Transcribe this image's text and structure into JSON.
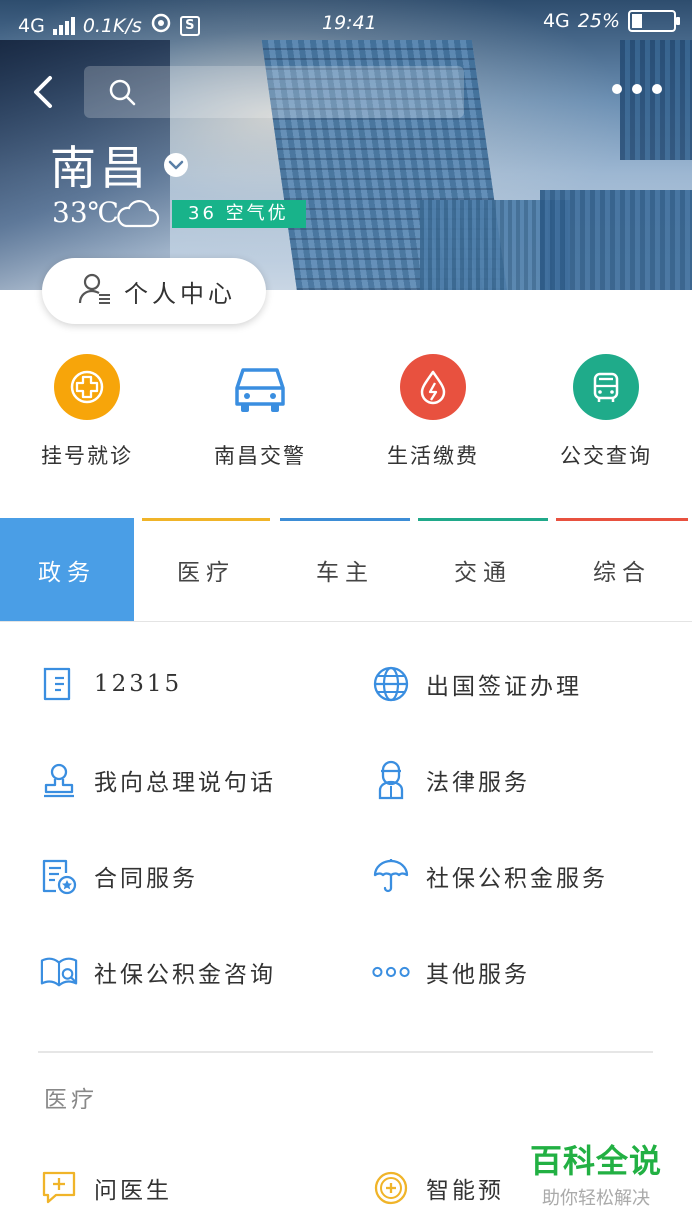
{
  "status_bar": {
    "network": "4G",
    "speed": "0.1K/s",
    "time": "19:41",
    "network_right": "4G",
    "battery": "25%"
  },
  "search": {
    "placeholder": ""
  },
  "location": {
    "city": "南昌",
    "temperature": "33℃",
    "weather_icon": "cloud-icon",
    "air_quality": "36 空气优",
    "air_quality_color": "#18b38a"
  },
  "personal_center": {
    "label": "个人中心"
  },
  "quick_services": [
    {
      "label": "挂号就诊",
      "icon": "medical-cross-icon",
      "color": "#f7a50a"
    },
    {
      "label": "南昌交警",
      "icon": "car-icon",
      "color": "#3a8ee0"
    },
    {
      "label": "生活缴费",
      "icon": "bill-payment-icon",
      "color": "#e8513f"
    },
    {
      "label": "公交查询",
      "icon": "bus-icon",
      "color": "#1fab8a"
    }
  ],
  "tabs": [
    {
      "label": "政务",
      "color": "#4a9ee6",
      "active": true
    },
    {
      "label": "医疗",
      "color": "#f0b429"
    },
    {
      "label": "车主",
      "color": "#3d8dd6"
    },
    {
      "label": "交通",
      "color": "#20a98a"
    },
    {
      "label": "综合",
      "color": "#e8513f"
    }
  ],
  "government_services": [
    {
      "label": "12315",
      "icon": "document-icon"
    },
    {
      "label": "出国签证办理",
      "icon": "globe-icon"
    },
    {
      "label": "我向总理说句话",
      "icon": "stamp-icon"
    },
    {
      "label": "法律服务",
      "icon": "judge-icon"
    },
    {
      "label": "合同服务",
      "icon": "contract-icon"
    },
    {
      "label": "社保公积金服务",
      "icon": "umbrella-icon"
    },
    {
      "label": "社保公积金咨询",
      "icon": "book-search-icon"
    },
    {
      "label": "其他服务",
      "icon": "more-dots-icon"
    }
  ],
  "medical_section": {
    "title": "医疗",
    "items": [
      {
        "label": "问医生",
        "icon": "chat-plus-icon"
      },
      {
        "label": "智能预",
        "icon": "smart-plus-icon"
      }
    ]
  },
  "watermark": {
    "line1": "百科全说",
    "line2": "助你轻松解决"
  },
  "accent_color": "#4a9ee6",
  "icon_color": "#3a8ee0"
}
